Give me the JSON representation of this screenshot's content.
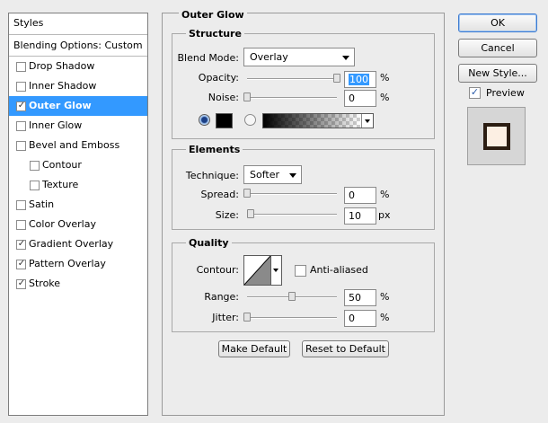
{
  "styles_panel": {
    "header": "Styles",
    "blending_options": "Blending Options: Custom",
    "items": [
      {
        "label": "Drop Shadow",
        "checked": false
      },
      {
        "label": "Inner Shadow",
        "checked": false
      },
      {
        "label": "Outer Glow",
        "checked": true,
        "selected": true
      },
      {
        "label": "Inner Glow",
        "checked": false
      },
      {
        "label": "Bevel and Emboss",
        "checked": false
      },
      {
        "label": "Contour",
        "checked": false,
        "sub": true
      },
      {
        "label": "Texture",
        "checked": false,
        "sub": true
      },
      {
        "label": "Satin",
        "checked": false
      },
      {
        "label": "Color Overlay",
        "checked": false
      },
      {
        "label": "Gradient Overlay",
        "checked": true
      },
      {
        "label": "Pattern Overlay",
        "checked": true
      },
      {
        "label": "Stroke",
        "checked": true
      }
    ]
  },
  "outer_glow": {
    "title": "Outer Glow",
    "structure": {
      "title": "Structure",
      "blend_mode_label": "Blend Mode:",
      "blend_mode_value": "Overlay",
      "opacity_label": "Opacity:",
      "opacity_value": "100",
      "opacity_fraction": 1.0,
      "noise_label": "Noise:",
      "noise_value": "0",
      "noise_fraction": 0.0,
      "percent": "%",
      "color_swatch": "#000000"
    },
    "elements": {
      "title": "Elements",
      "technique_label": "Technique:",
      "technique_value": "Softer",
      "spread_label": "Spread:",
      "spread_value": "0",
      "spread_fraction": 0.0,
      "size_label": "Size:",
      "size_value": "10",
      "size_fraction": 0.04,
      "percent": "%",
      "px": "px"
    },
    "quality": {
      "title": "Quality",
      "contour_label": "Contour:",
      "anti_aliased_label": "Anti-aliased",
      "anti_aliased_checked": false,
      "range_label": "Range:",
      "range_value": "50",
      "range_fraction": 0.5,
      "jitter_label": "Jitter:",
      "jitter_value": "0",
      "jitter_fraction": 0.0,
      "percent": "%"
    },
    "make_default_label": "Make Default",
    "reset_default_label": "Reset to Default"
  },
  "actions": {
    "ok_label": "OK",
    "cancel_label": "Cancel",
    "new_style_label": "New Style...",
    "preview_label": "Preview",
    "preview_checked": true
  },
  "colors": {
    "selection": "#3399ff",
    "preview_fill": "#fcefe3",
    "preview_border": "#2b1d12"
  }
}
